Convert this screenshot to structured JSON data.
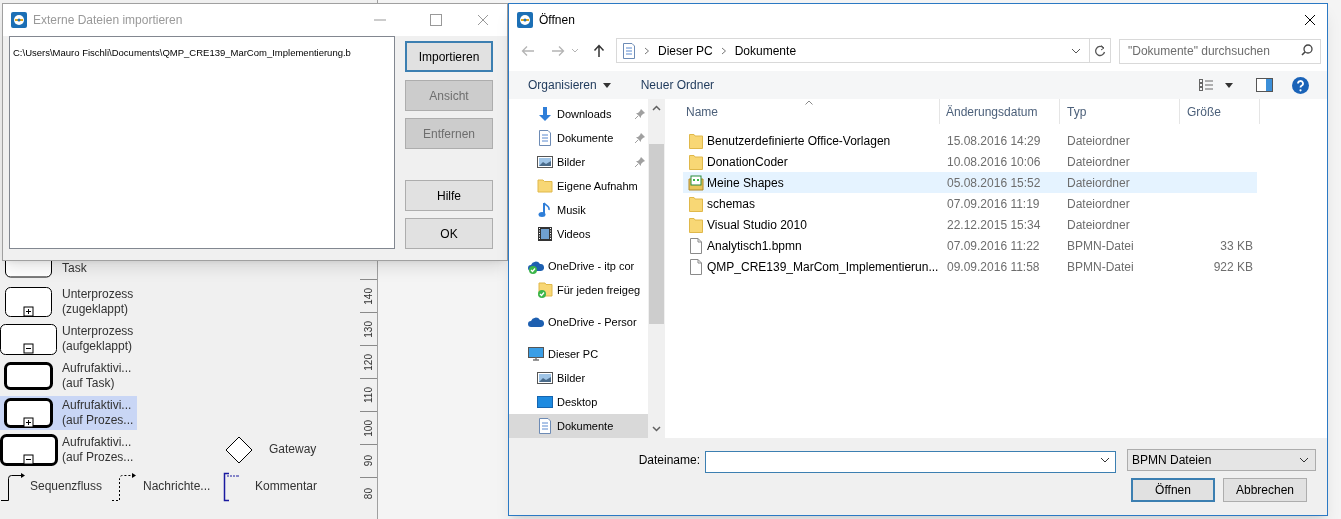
{
  "background": {
    "palette": {
      "rows": [
        [
          {
            "kind": "task",
            "lines": [
              "Task"
            ],
            "selected": false
          }
        ],
        [
          {
            "kind": "subprocess-collapsed",
            "lines": [
              "Unterprozess",
              "(zugeklappt)"
            ],
            "selected": false
          }
        ],
        [
          {
            "kind": "subprocess-expanded",
            "lines": [
              "Unterprozess",
              "(aufgeklappt)"
            ],
            "selected": false
          }
        ],
        [
          {
            "kind": "call-task",
            "lines": [
              "Aufrufaktivi...",
              "(auf Task)"
            ],
            "selected": false
          }
        ],
        [
          {
            "kind": "call-collapsed",
            "lines": [
              "Aufrufaktivi...",
              "(auf Prozes..."
            ],
            "selected": true
          }
        ],
        [
          {
            "kind": "call-expanded",
            "lines": [
              "Aufrufaktivi...",
              "(auf Prozes..."
            ],
            "selected": false
          },
          "",
          {
            "kind": "gateway",
            "lines": [
              "Gateway"
            ],
            "selected": false
          }
        ],
        [
          {
            "kind": "sequence-flow",
            "lines": [
              "Sequenzfluss"
            ],
            "selected": false
          },
          {
            "kind": "message-flow",
            "lines": [
              "Nachrichte..."
            ],
            "selected": false
          },
          {
            "kind": "annotation",
            "lines": [
              "Kommentar"
            ],
            "selected": false
          }
        ]
      ]
    },
    "ruler": {
      "ticks": [
        "140",
        "130",
        "120",
        "110",
        "100",
        "90",
        "80"
      ]
    }
  },
  "import_dialog": {
    "title": "Externe Dateien importieren",
    "active": false,
    "files": [
      "C:\\Users\\Mauro Fischli\\Documents\\QMP_CRE139_MarCom_Implementierung.b"
    ],
    "buttons": [
      {
        "label": "Importieren",
        "disabled": false,
        "default": true
      },
      {
        "label": "Ansicht",
        "disabled": true,
        "default": false
      },
      {
        "label": "Entfernen",
        "disabled": true,
        "default": false
      },
      {
        "label": "Hilfe",
        "disabled": false,
        "default": false
      },
      {
        "label": "OK",
        "disabled": false,
        "default": false
      }
    ]
  },
  "open_dialog": {
    "title": "Öffnen",
    "active": true,
    "address": {
      "path": [
        "Dieser PC",
        "Dokumente"
      ]
    },
    "search": {
      "placeholder": "\"Dokumente\" durchsuchen"
    },
    "toolbar": {
      "organize": "Organisieren",
      "new_folder": "Neuer Ordner"
    },
    "nav": {
      "quick_access": [
        {
          "kind": "downloads",
          "label": "Downloads",
          "pinned": true,
          "selected": false
        },
        {
          "kind": "documents",
          "label": "Dokumente",
          "pinned": true,
          "selected": false
        },
        {
          "kind": "pictures",
          "label": "Bilder",
          "pinned": true,
          "selected": false
        },
        {
          "kind": "folder",
          "label": "Eigene Aufnahm",
          "pinned": false,
          "selected": false
        },
        {
          "kind": "music",
          "label": "Musik",
          "pinned": false,
          "selected": false
        },
        {
          "kind": "videos",
          "label": "Videos",
          "pinned": false,
          "selected": false
        }
      ],
      "tree": [
        {
          "kind": "cloud-synced",
          "label": "OneDrive - itp cor",
          "selected": false,
          "children": [
            {
              "kind": "shared-folder",
              "label": "Für jeden freigeg",
              "selected": false
            }
          ]
        },
        {
          "kind": "cloud",
          "label": "OneDrive - Persor",
          "selected": false
        },
        {
          "kind": "computer",
          "label": "Dieser PC",
          "selected": false,
          "children": [
            {
              "kind": "pictures",
              "label": "Bilder",
              "selected": false
            },
            {
              "kind": "desktop",
              "label": "Desktop",
              "selected": false
            },
            {
              "kind": "documents",
              "label": "Dokumente",
              "selected": true
            }
          ]
        }
      ]
    },
    "columns": [
      {
        "label": "Name",
        "sorted": true
      },
      {
        "label": "Änderungsdatum",
        "sorted": false
      },
      {
        "label": "Typ",
        "sorted": false
      },
      {
        "label": "Größe",
        "sorted": false
      }
    ],
    "files": [
      {
        "kind": "folder",
        "name": "Benutzerdefinierte Office-Vorlagen",
        "date": "15.08.2016 14:29",
        "type": "Dateiordner",
        "selected": false
      },
      {
        "kind": "folder",
        "name": "DonationCoder",
        "date": "10.08.2016 10:06",
        "type": "Dateiordner",
        "selected": false
      },
      {
        "kind": "shapes",
        "name": "Meine Shapes",
        "date": "05.08.2016 15:52",
        "type": "Dateiordner",
        "selected": true
      },
      {
        "kind": "folder",
        "name": "schemas",
        "date": "07.09.2016 11:19",
        "type": "Dateiordner",
        "selected": false
      },
      {
        "kind": "folder",
        "name": "Visual Studio 2010",
        "date": "22.12.2015 15:34",
        "type": "Dateiordner",
        "selected": false
      },
      {
        "kind": "file",
        "name": "Analytisch1.bpmn",
        "date": "07.09.2016 11:22",
        "type": "BPMN-Datei",
        "size": "33 KB",
        "selected": false
      },
      {
        "kind": "file",
        "name": "QMP_CRE139_MarCom_Implementierun...",
        "date": "09.09.2016 11:58",
        "type": "BPMN-Datei",
        "size": "922 KB",
        "selected": false
      }
    ],
    "filename_label": "Dateiname:",
    "file_type": "BPMN Dateien",
    "buttons": [
      {
        "label": "Öffnen",
        "default": true
      },
      {
        "label": "Abbrechen",
        "default": false
      }
    ]
  }
}
